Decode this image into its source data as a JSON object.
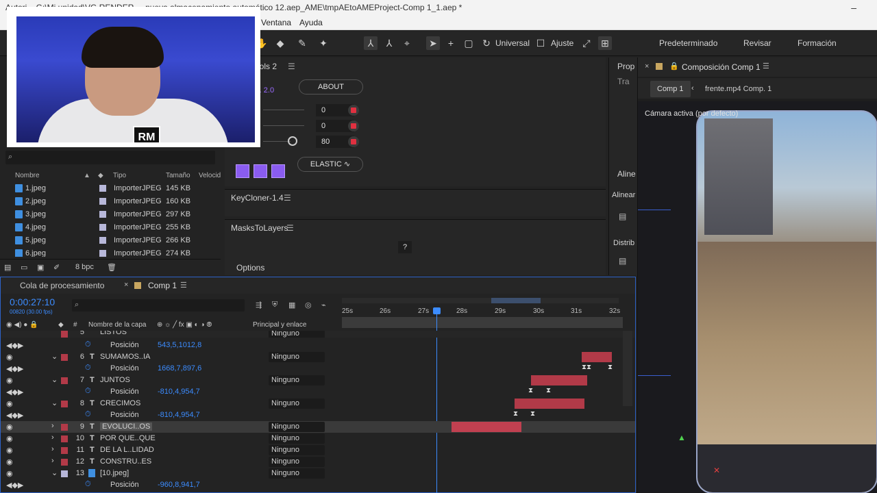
{
  "window": {
    "title": "Autori... G:\\Mi unidad\\VG RENDER ... nueva almacenamiento automático 12.aep_AME\\tmpAEtoAMEProject-Comp 1_1.aep *"
  },
  "menu": {
    "items": [
      "Ventana",
      "Ayuda"
    ]
  },
  "toolbar": {
    "universal_label": "Universal",
    "ajuste_label": "Ajuste",
    "workspaces": [
      "Predeterminado",
      "Revisar",
      "Formación"
    ]
  },
  "project": {
    "search_placeholder": "",
    "columns": {
      "name": "Nombre",
      "type": "Tipo",
      "size": "Tamaño",
      "speed": "Velocid"
    },
    "items": [
      {
        "name": "1.jpeg",
        "type": "ImporterJPEG",
        "size": "145 KB"
      },
      {
        "name": "2.jpeg",
        "type": "ImporterJPEG",
        "size": "160 KB"
      },
      {
        "name": "3.jpeg",
        "type": "ImporterJPEG",
        "size": "297 KB"
      },
      {
        "name": "4.jpeg",
        "type": "ImporterJPEG",
        "size": "255 KB"
      },
      {
        "name": "5.jpeg",
        "type": "ImporterJPEG",
        "size": "266 KB"
      },
      {
        "name": "6.jpeg",
        "type": "ImporterJPEG",
        "size": "274 KB"
      }
    ],
    "bpc": "8 bpc"
  },
  "tools2": {
    "title": "ools 2",
    "version": "v. 2.0",
    "about": "ABOUT",
    "values": [
      "0",
      "0",
      "80"
    ],
    "elastic": "ELASTIC"
  },
  "keycloner": {
    "title": "KeyCloner-1.4"
  },
  "masks": {
    "title": "MasksToLayers",
    "help": "?",
    "options": "Options"
  },
  "side": {
    "prop": "Prop",
    "tra": "Tra",
    "aline": "Aline",
    "alinear": "Alinear",
    "distrib": "Distrib"
  },
  "comp": {
    "tab_title": "Composición Comp 1",
    "subtab_active": "Comp 1",
    "subtab_other": "frente.mp4 Comp. 1",
    "camera": "Cámara activa (por defecto)"
  },
  "timeline": {
    "tab_queue": "Cola de procesamiento",
    "tab_comp": "Comp 1",
    "timecode": "0:00:27:10",
    "fps": "00820 (30.00 fps)",
    "col_name": "Nombre de la capa",
    "col_parent": "Principal y enlace",
    "ruler": [
      "25s",
      "26s",
      "27s",
      "28s",
      "29s",
      "30s",
      "31s",
      "32s"
    ],
    "rows": [
      {
        "kind": "layer",
        "num": "5",
        "name": "LISTOS",
        "parent": "Ninguno",
        "color": "#b23a48"
      },
      {
        "kind": "prop",
        "name": "Posición",
        "value": "543,5,1012,8"
      },
      {
        "kind": "layer",
        "num": "6",
        "name": "SUMAMOS..IA",
        "parent": "Ninguno",
        "color": "#b23a48"
      },
      {
        "kind": "prop",
        "name": "Posición",
        "value": "1668,7,897,6"
      },
      {
        "kind": "layer",
        "num": "7",
        "name": "JUNTOS",
        "parent": "Ninguno",
        "color": "#b23a48"
      },
      {
        "kind": "prop",
        "name": "Posición",
        "value": "-810,4,954,7"
      },
      {
        "kind": "layer",
        "num": "8",
        "name": "CRECIMOS",
        "parent": "Ninguno",
        "color": "#b23a48"
      },
      {
        "kind": "prop",
        "name": "Posición",
        "value": "-810,4,954,7"
      },
      {
        "kind": "layer",
        "num": "9",
        "name": "EVOLUCI..OS",
        "parent": "Ninguno",
        "color": "#b23a48"
      },
      {
        "kind": "layer",
        "num": "10",
        "name": "POR QUE..QUE",
        "parent": "Ninguno",
        "color": "#b23a48"
      },
      {
        "kind": "layer",
        "num": "11",
        "name": "DE LA L..LIDAD",
        "parent": "Ninguno",
        "color": "#b23a48"
      },
      {
        "kind": "layer",
        "num": "12",
        "name": "CONSTRU..ES",
        "parent": "Ninguno",
        "color": "#b23a48"
      },
      {
        "kind": "layer",
        "num": "13",
        "name": "[10.jpeg]",
        "parent": "Ninguno",
        "color": "#b7b7d9"
      },
      {
        "kind": "prop",
        "name": "Posición",
        "value": "-960,8,941,7"
      }
    ]
  }
}
